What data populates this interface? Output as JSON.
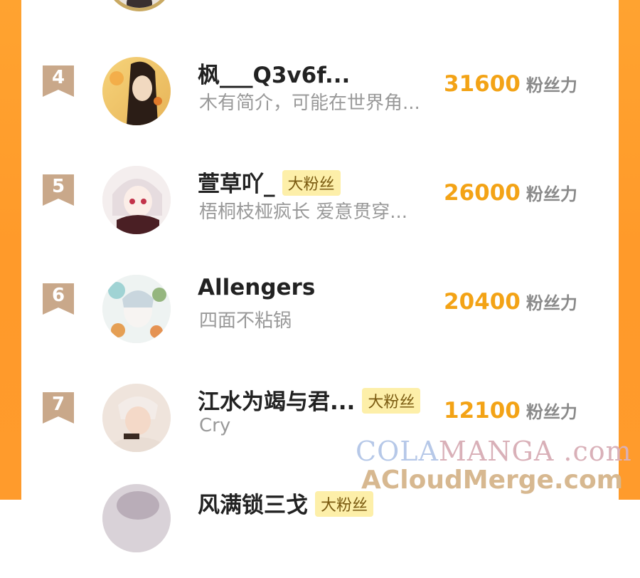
{
  "colors": {
    "side_orange": "#ff9f2e",
    "score_orange": "#f3a316",
    "rank_badge": "#c9a88a",
    "badge_bg": "#fdefa9",
    "name_color": "#222222",
    "bio_color": "#999999"
  },
  "unit_label": "粉丝力",
  "rows": [
    {
      "rank": "4",
      "name": "枫___Q3v6f...",
      "badge": "",
      "bio": "木有简介，可能在世界角...",
      "score": "31600"
    },
    {
      "rank": "5",
      "name": "萱草吖_",
      "badge": "大粉丝",
      "bio": "梧桐枝桠疯长 爱意贯穿...",
      "score": "26000"
    },
    {
      "rank": "6",
      "name": "Allengers",
      "badge": "",
      "bio": "四面不粘锅",
      "score": "20400"
    },
    {
      "rank": "7",
      "name": "江水为竭与君...",
      "badge": "大粉丝",
      "bio": "Cry",
      "score": "12100"
    }
  ],
  "partial_next": {
    "name": "风满锁三戈",
    "badge": "大粉丝"
  },
  "watermark": {
    "line1_a": "COLA",
    "line1_b": "MANGA",
    "line1_c": " .com",
    "line2": "ACloudMerge.com"
  }
}
